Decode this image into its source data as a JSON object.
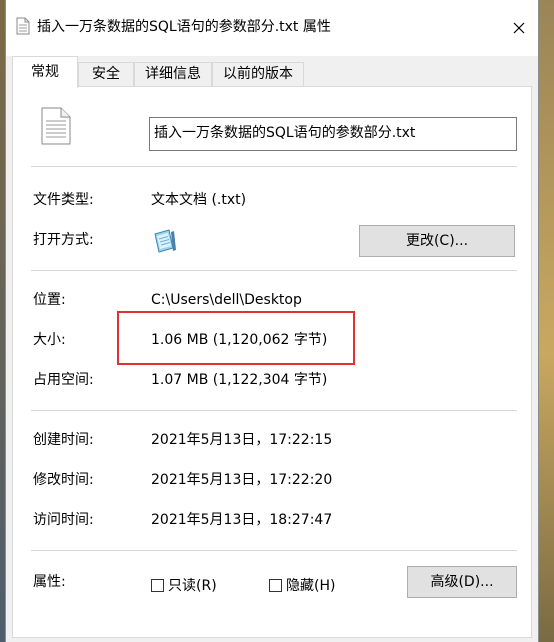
{
  "window": {
    "title": "插入一万条数据的SQL语句的参数部分.txt 属性",
    "close_symbol": "✕"
  },
  "tabs": [
    {
      "label": "常规",
      "active": true
    },
    {
      "label": "安全",
      "active": false
    },
    {
      "label": "详细信息",
      "active": false
    },
    {
      "label": "以前的版本",
      "active": false
    }
  ],
  "general": {
    "file_name": "插入一万条数据的SQL语句的参数部分.txt",
    "file_type_label": "文件类型:",
    "file_type_value": "文本文档 (.txt)",
    "open_with_label": "打开方式:",
    "change_button": "更改(C)...",
    "location_label": "位置:",
    "location_value": "C:\\Users\\dell\\Desktop",
    "size_label": "大小:",
    "size_value": "1.06 MB (1,120,062 字节)",
    "size_on_disk_label": "占用空间:",
    "size_on_disk_value": "1.07 MB (1,122,304 字节)",
    "created_label": "创建时间:",
    "created_value": "2021年5月13日，17:22:15",
    "modified_label": "修改时间:",
    "modified_value": "2021年5月13日，17:22:20",
    "accessed_label": "访问时间:",
    "accessed_value": "2021年5月13日，18:27:47",
    "attributes_label": "属性:",
    "readonly_label": "只读(R)",
    "readonly_checked": false,
    "hidden_label": "隐藏(H)",
    "hidden_checked": false,
    "advanced_button": "高级(D)..."
  },
  "icons": {
    "title": "text-file-icon",
    "file": "text-file-icon",
    "open_with": "notepad-icon",
    "close": "close-icon"
  },
  "colors": {
    "highlight": "#e03030",
    "button_face": "#e1e1e1"
  }
}
